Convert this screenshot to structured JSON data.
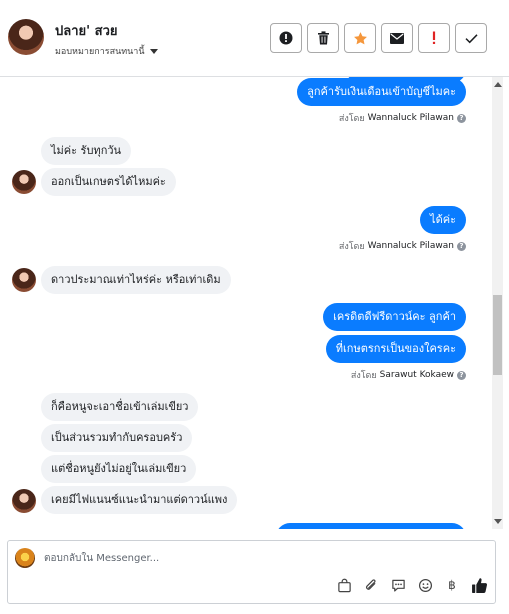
{
  "header": {
    "contact_name": "ปลาย' สวย",
    "assign_label": "มอบหมายการสนทนานี้",
    "actions": [
      {
        "icon": "exclamation-circle-icon",
        "color": "#1c1e21"
      },
      {
        "icon": "trash-icon",
        "color": "#1c1e21"
      },
      {
        "icon": "star-icon",
        "color": "#f5973c"
      },
      {
        "icon": "envelope-icon",
        "color": "#1c1e21"
      },
      {
        "icon": "exclamation-icon",
        "color": "#e02424"
      },
      {
        "icon": "check-icon",
        "color": "#1c1e21"
      }
    ]
  },
  "messages": [
    {
      "dir": "out",
      "text": "ลูกค้ารับเงินเดือนเข้าบัญชีไมคะ"
    },
    {
      "dir": "meta",
      "prefix": "ส่งโดย",
      "name": "Wannaluck Pilawan"
    },
    {
      "dir": "in",
      "text": "ไม่ค่ะ รับทุกวัน"
    },
    {
      "dir": "in",
      "text": "ออกเป็นเกษตรได้ไหมค่ะ"
    },
    {
      "dir": "out",
      "text": "ได้ค่ะ"
    },
    {
      "dir": "meta",
      "prefix": "ส่งโดย",
      "name": "Wannaluck Pilawan"
    },
    {
      "dir": "in",
      "text": "ดาวประมาณเท่าไหร่ค่ะ หรือเท่าเดิม"
    },
    {
      "dir": "out",
      "text": "เครดิตดีฟรีดาวน์คะ ลูกค้า"
    },
    {
      "dir": "out",
      "text": "ที่เกษตรกรเป็นของใครคะ"
    },
    {
      "dir": "meta",
      "prefix": "ส่งโดย",
      "name": "Sarawut Kokaew"
    },
    {
      "dir": "in",
      "text": "ก็คือหนูจะเอาชื่อเข้าเล่มเขียว"
    },
    {
      "dir": "in",
      "text": "เป็นส่วนรวมทำกับครอบครัว"
    },
    {
      "dir": "in",
      "text": "แต่ชื่อหนูยังไม่อยู่ในเล่มเขียว"
    },
    {
      "dir": "in",
      "text": "เคยมีไฟแนนซ์แนะนำมาแต่ดาวน์แพง"
    }
  ],
  "composer": {
    "placeholder": "ตอบกลับใน Messenger...",
    "tools": [
      "bag-icon",
      "paperclip-icon",
      "chat-bubble-icon",
      "smiley-icon",
      "baht-icon",
      "thumbs-up-icon"
    ],
    "baht_symbol": "฿"
  },
  "colors": {
    "outgoing_bubble": "#0a7cff",
    "incoming_bubble": "#f0f2f5"
  }
}
